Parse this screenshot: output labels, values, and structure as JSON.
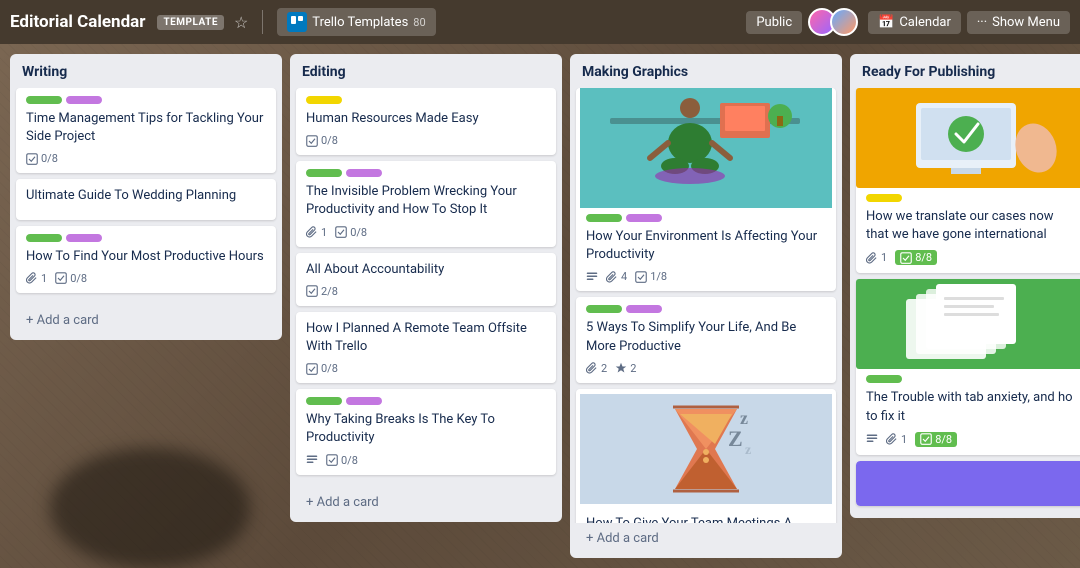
{
  "header": {
    "title": "Editorial Calendar",
    "template_badge": "TEMPLATE",
    "trello_templates_label": "Trello Templates",
    "member_count": "80",
    "public_label": "Public",
    "calendar_label": "Calendar",
    "show_menu_label": "Show Menu"
  },
  "lists": [
    {
      "id": "writing",
      "title": "Writing",
      "cards": [
        {
          "id": "w1",
          "title": "Time Management Tips for Tackling Your Side Project",
          "labels": [
            {
              "color": "green"
            },
            {
              "color": "purple"
            }
          ],
          "meta": [
            {
              "icon": "checklist",
              "text": "0/8"
            }
          ],
          "image": null
        },
        {
          "id": "w2",
          "title": "Ultimate Guide To Wedding Planning",
          "labels": [],
          "meta": [],
          "image": null
        },
        {
          "id": "w3",
          "title": "How To Find Your Most Productive Hours",
          "labels": [
            {
              "color": "green"
            },
            {
              "color": "purple"
            }
          ],
          "meta": [
            {
              "icon": "attachment",
              "text": "1"
            },
            {
              "icon": "checklist",
              "text": "0/8"
            }
          ],
          "image": null
        }
      ]
    },
    {
      "id": "editing",
      "title": "Editing",
      "cards": [
        {
          "id": "e1",
          "title": "Human Resources Made Easy",
          "labels": [
            {
              "color": "yellow"
            }
          ],
          "meta": [
            {
              "icon": "checklist",
              "text": "0/8"
            }
          ],
          "image": null
        },
        {
          "id": "e2",
          "title": "The Invisible Problem Wrecking Your Productivity and How To Stop It",
          "labels": [
            {
              "color": "green"
            },
            {
              "color": "purple"
            }
          ],
          "meta": [
            {
              "icon": "attachment",
              "text": "1"
            },
            {
              "icon": "checklist",
              "text": "0/8"
            }
          ],
          "image": null
        },
        {
          "id": "e3",
          "title": "All About Accountability",
          "labels": [],
          "meta": [
            {
              "icon": "checklist",
              "text": "2/8"
            }
          ],
          "image": null
        },
        {
          "id": "e4",
          "title": "How I Planned A Remote Team Offsite With Trello",
          "labels": [],
          "meta": [
            {
              "icon": "checklist",
              "text": "0/8"
            }
          ],
          "image": null
        },
        {
          "id": "e5",
          "title": "Why Taking Breaks Is The Key To Productivity",
          "labels": [
            {
              "color": "green"
            },
            {
              "color": "purple"
            }
          ],
          "meta": [
            {
              "icon": "description"
            },
            {
              "icon": "checklist",
              "text": "0/8"
            }
          ],
          "image": null
        }
      ]
    },
    {
      "id": "making-graphics",
      "title": "Making Graphics",
      "cards": [
        {
          "id": "mg1",
          "title": "How Your Environment Is Affecting Your Productivity",
          "labels": [
            {
              "color": "green"
            },
            {
              "color": "purple"
            }
          ],
          "meta": [
            {
              "icon": "description"
            },
            {
              "icon": "attachment",
              "text": "4"
            },
            {
              "icon": "checklist",
              "text": "1/8"
            }
          ],
          "image": "meditation"
        },
        {
          "id": "mg2",
          "title": "5 Ways To Simplify Your Life, And Be More Productive",
          "labels": [
            {
              "color": "green"
            },
            {
              "color": "purple"
            }
          ],
          "meta": [
            {
              "icon": "attachment",
              "text": "2"
            },
            {
              "icon": "power-up",
              "text": "2"
            }
          ],
          "image": null
        },
        {
          "id": "mg3",
          "title": "How To Give Your Team Meetings A",
          "labels": [],
          "meta": [],
          "image": "sleep"
        }
      ]
    },
    {
      "id": "ready-for-publishing",
      "title": "Ready For Publishing",
      "cards": [
        {
          "id": "rfp1",
          "title": "How we translate our cases now that we have gone international",
          "labels": [
            {
              "color": "yellow"
            }
          ],
          "meta": [
            {
              "icon": "attachment",
              "text": "1"
            },
            {
              "icon": "checklist-green",
              "text": "8/8"
            }
          ],
          "image": "translate"
        },
        {
          "id": "rfp2",
          "title": "The Trouble with tab anxiety, and ho to fix it",
          "labels": [
            {
              "color": "green"
            }
          ],
          "meta": [
            {
              "icon": "description"
            },
            {
              "icon": "attachment",
              "text": "1"
            },
            {
              "icon": "checklist-green",
              "text": "8/8"
            }
          ],
          "image": "tabs"
        },
        {
          "id": "rfp3",
          "title": "",
          "labels": [],
          "meta": [],
          "image": "purple"
        }
      ]
    }
  ],
  "add_card_label": "+ Add a card"
}
